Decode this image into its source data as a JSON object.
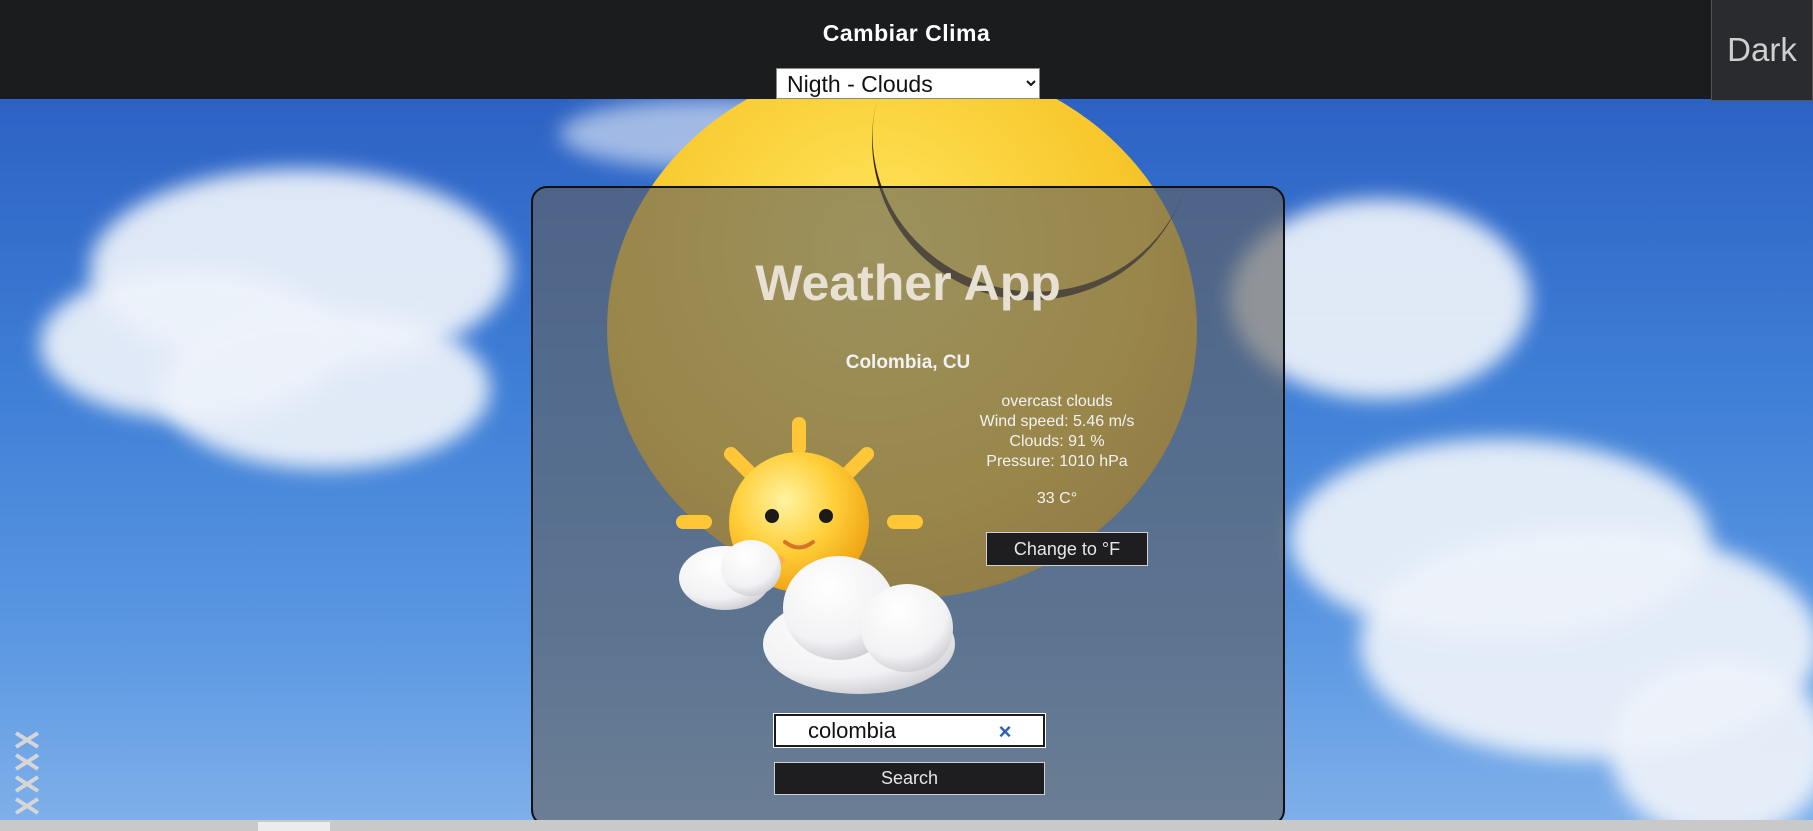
{
  "header": {
    "title": "Cambiar Clima",
    "weather_select": {
      "selected": "Nigth - Clouds",
      "options": [
        "Nigth - Clouds"
      ]
    },
    "theme_button_label": "Dark"
  },
  "card": {
    "title": "Weather App",
    "location": "Colombia, CU",
    "details": {
      "description": "overcast clouds",
      "wind": "Wind speed: 5.46 m/s",
      "clouds": "Clouds: 91 %",
      "pressure": "Pressure: 1010 hPa"
    },
    "temperature": "33 C°",
    "change_unit_label": "Change to °F",
    "weather_icon": "sun-behind-clouds-icon",
    "search": {
      "value": "colombia",
      "clear_icon": "×",
      "button_label": "Search"
    }
  },
  "colors": {
    "header_bg": "#1b1c1e",
    "sky_blue": "#3f7fd6",
    "card_overlay": "#5f5f5f",
    "title_text": "#e8e0d2",
    "clear_icon": "#2c5fb6"
  }
}
